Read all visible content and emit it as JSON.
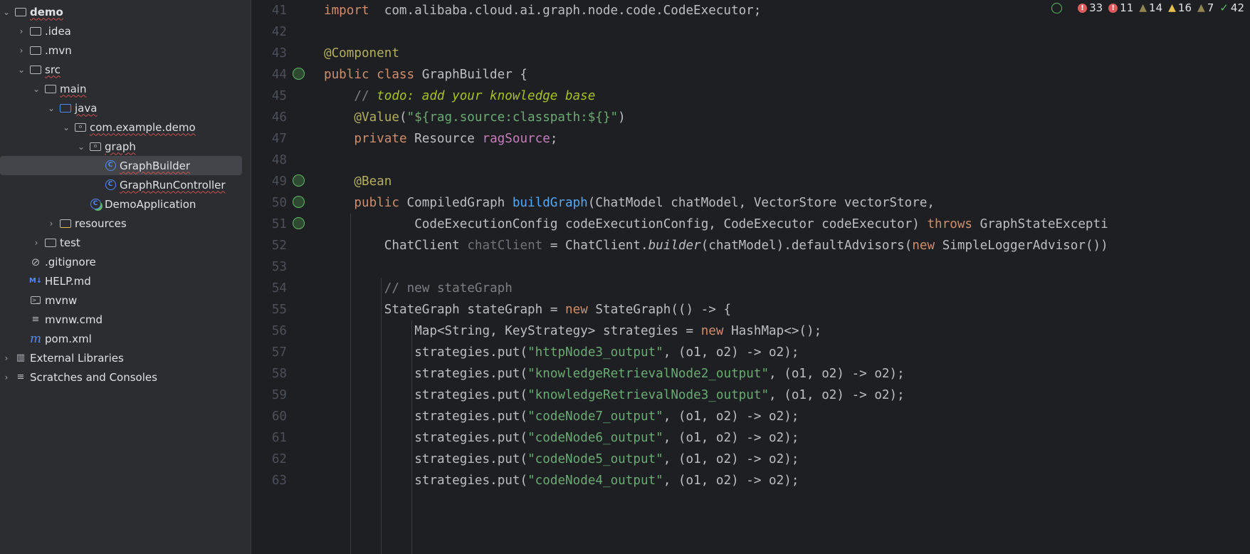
{
  "project_tree": [
    {
      "label": "demo",
      "level": 0,
      "chevron": "down",
      "icon": "project-folder-icon",
      "bold": true,
      "wavy": true
    },
    {
      "label": ".idea",
      "level": 1,
      "chevron": "right",
      "icon": "folder-icon"
    },
    {
      "label": ".mvn",
      "level": 1,
      "chevron": "right",
      "icon": "folder-icon"
    },
    {
      "label": "src",
      "level": 1,
      "chevron": "down",
      "icon": "folder-icon",
      "wavy": true
    },
    {
      "label": "main",
      "level": 2,
      "chevron": "down",
      "icon": "folder-icon",
      "wavy": true
    },
    {
      "label": "java",
      "level": 3,
      "chevron": "down",
      "icon": "source-folder-icon",
      "wavy": true
    },
    {
      "label": "com.example.demo",
      "level": 4,
      "chevron": "down",
      "icon": "package-icon",
      "wavy": true
    },
    {
      "label": "graph",
      "level": 5,
      "chevron": "down",
      "icon": "package-icon",
      "wavy": true
    },
    {
      "label": "GraphBuilder",
      "level": 6,
      "icon": "class-icon",
      "selected": true,
      "wavy": true
    },
    {
      "label": "GraphRunController",
      "level": 6,
      "icon": "class-icon",
      "wavy": true
    },
    {
      "label": "DemoApplication",
      "level": 5,
      "icon": "spring-boot-class-icon"
    },
    {
      "label": "resources",
      "level": 3,
      "chevron": "right",
      "icon": "resources-folder-icon"
    },
    {
      "label": "test",
      "level": 2,
      "chevron": "right",
      "icon": "folder-icon"
    },
    {
      "label": ".gitignore",
      "level": 1,
      "icon": "gitignore-icon"
    },
    {
      "label": "HELP.md",
      "level": 1,
      "icon": "markdown-icon"
    },
    {
      "label": "mvnw",
      "level": 1,
      "icon": "terminal-script-icon"
    },
    {
      "label": "mvnw.cmd",
      "level": 1,
      "icon": "text-file-icon"
    },
    {
      "label": "pom.xml",
      "level": 1,
      "icon": "maven-icon"
    },
    {
      "label": "External Libraries",
      "level": 0,
      "chevron": "right",
      "icon": "library-icon"
    },
    {
      "label": "Scratches and Consoles",
      "level": 0,
      "chevron": "right",
      "icon": "scratches-icon"
    }
  ],
  "inspections": {
    "errors_a": "33",
    "errors_b": "11",
    "warnings_a": "14",
    "warnings_b": "16",
    "warnings_c": "7",
    "typos": "42",
    "colors": {
      "error": "#db5c5c",
      "warning": "#e6c04d",
      "weak_warning": "#8f8552",
      "ok": "#5fb865"
    }
  },
  "editor": {
    "file": "GraphBuilder",
    "lines": [
      {
        "n": "41",
        "i": 0,
        "tokens": [
          [
            "kw",
            "import"
          ],
          [
            "",
            "  com.alibaba.cloud.ai.graph.node.code.CodeExecutor;"
          ]
        ]
      },
      {
        "n": "42",
        "i": 0,
        "tokens": []
      },
      {
        "n": "43",
        "i": 0,
        "tokens": [
          [
            "ann",
            "@Component"
          ]
        ]
      },
      {
        "n": "44",
        "i": 0,
        "gutter": "bean-icon",
        "tokens": [
          [
            "kw",
            "public class "
          ],
          [
            "",
            "GraphBuilder {"
          ]
        ]
      },
      {
        "n": "45",
        "i": 4,
        "tokens": [
          [
            "com",
            "// "
          ],
          [
            "todo",
            "todo: add your knowledge base"
          ]
        ]
      },
      {
        "n": "46",
        "i": 4,
        "tokens": [
          [
            "ann",
            "@Value"
          ],
          [
            "",
            "("
          ],
          [
            "str",
            "\"${rag.source:classpath:${}\""
          ],
          [
            "",
            ")"
          ]
        ]
      },
      {
        "n": "47",
        "i": 4,
        "tokens": [
          [
            "kw",
            "private "
          ],
          [
            "",
            "Resource "
          ],
          [
            "fld",
            "ragSource"
          ],
          [
            "",
            ";"
          ]
        ]
      },
      {
        "n": "48",
        "i": 0,
        "tokens": []
      },
      {
        "n": "49",
        "i": 4,
        "gutter": "bean-icon",
        "tokens": [
          [
            "ann",
            "@Bean"
          ]
        ]
      },
      {
        "n": "50",
        "i": 4,
        "gutter": "bean-icon",
        "tokens": [
          [
            "kw",
            "public "
          ],
          [
            "",
            "CompiledGraph "
          ],
          [
            "mth",
            "buildGraph"
          ],
          [
            "",
            "(ChatModel chatModel, VectorStore vectorStore,"
          ]
        ]
      },
      {
        "n": "51",
        "i": 12,
        "gutter": "bean-icon",
        "tokens": [
          [
            "",
            "CodeExecutionConfig codeExecutionConfig, CodeExecutor codeExecutor) "
          ],
          [
            "kw",
            "throws "
          ],
          [
            "",
            "GraphStateExcepti"
          ]
        ]
      },
      {
        "n": "52",
        "i": 8,
        "tokens": [
          [
            "",
            "ChatClient "
          ],
          [
            "unused",
            "chatClient"
          ],
          [
            "",
            " = ChatClient."
          ],
          [
            "ital",
            "builder"
          ],
          [
            "",
            "(chatModel).defaultAdvisors("
          ],
          [
            "kw",
            "new "
          ],
          [
            "",
            "SimpleLoggerAdvisor())"
          ]
        ]
      },
      {
        "n": "53",
        "i": 0,
        "tokens": []
      },
      {
        "n": "54",
        "i": 8,
        "tokens": [
          [
            "com",
            "// new stateGraph"
          ]
        ]
      },
      {
        "n": "55",
        "i": 8,
        "tokens": [
          [
            "",
            "StateGraph stateGraph = "
          ],
          [
            "kw",
            "new "
          ],
          [
            "",
            "StateGraph(() -> {"
          ]
        ]
      },
      {
        "n": "56",
        "i": 12,
        "tokens": [
          [
            "",
            "Map<String, KeyStrategy> strategies = "
          ],
          [
            "kw",
            "new "
          ],
          [
            "",
            "HashMap<>();"
          ]
        ]
      },
      {
        "n": "57",
        "i": 12,
        "tokens": [
          [
            "",
            "strategies.put("
          ],
          [
            "str",
            "\"httpNode3_output\""
          ],
          [
            "",
            ", (o1, o2) -> o2);"
          ]
        ]
      },
      {
        "n": "58",
        "i": 12,
        "tokens": [
          [
            "",
            "strategies.put("
          ],
          [
            "str",
            "\"knowledgeRetrievalNode2_output\""
          ],
          [
            "",
            ", (o1, o2) -> o2);"
          ]
        ]
      },
      {
        "n": "59",
        "i": 12,
        "tokens": [
          [
            "",
            "strategies.put("
          ],
          [
            "str",
            "\"knowledgeRetrievalNode3_output\""
          ],
          [
            "",
            ", (o1, o2) -> o2);"
          ]
        ]
      },
      {
        "n": "60",
        "i": 12,
        "tokens": [
          [
            "",
            "strategies.put("
          ],
          [
            "str",
            "\"codeNode7_output\""
          ],
          [
            "",
            ", (o1, o2) -> o2);"
          ]
        ]
      },
      {
        "n": "61",
        "i": 12,
        "tokens": [
          [
            "",
            "strategies.put("
          ],
          [
            "str",
            "\"codeNode6_output\""
          ],
          [
            "",
            ", (o1, o2) -> o2);"
          ]
        ]
      },
      {
        "n": "62",
        "i": 12,
        "tokens": [
          [
            "",
            "strategies.put("
          ],
          [
            "str",
            "\"codeNode5_output\""
          ],
          [
            "",
            ", (o1, o2) -> o2);"
          ]
        ]
      },
      {
        "n": "63",
        "i": 12,
        "tokens": [
          [
            "",
            "strategies.put("
          ],
          [
            "str",
            "\"codeNode4_output\""
          ],
          [
            "",
            ", (o1, o2) -> o2);"
          ]
        ]
      }
    ]
  }
}
